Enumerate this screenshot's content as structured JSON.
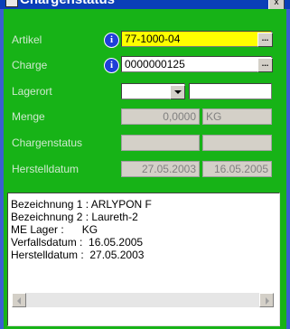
{
  "window": {
    "title": "Chargenstatus",
    "close_label": "x"
  },
  "form": {
    "artikel": {
      "label": "Artikel",
      "value": "77-1000-04",
      "info": "i",
      "lookup": "..."
    },
    "charge": {
      "label": "Charge",
      "value": "0000000125",
      "info": "i",
      "lookup": "..."
    },
    "lagerort": {
      "label": "Lagerort",
      "value": "",
      "value2": ""
    },
    "menge": {
      "label": "Menge",
      "value": "0,0000",
      "unit": "KG"
    },
    "chargenstatus": {
      "label": "Chargenstatus",
      "value": "",
      "value2": ""
    },
    "herstelldatum": {
      "label": "Herstelldatum",
      "value": "27.05.2003",
      "value2": "16.05.2005"
    }
  },
  "details": {
    "lines": [
      "Bezeichnung 1 : ARLYPON F",
      "Bezeichnung 2 : Laureth-2",
      "ME Lager :      KG",
      "Verfallsdatum :  16.05.2005",
      "Herstelldatum :  27.05.2003"
    ]
  },
  "colors": {
    "background": "#17b317",
    "highlight": "#ffff00",
    "title_bar": "#0a3fb8",
    "info_icon": "#1f3fd8"
  }
}
